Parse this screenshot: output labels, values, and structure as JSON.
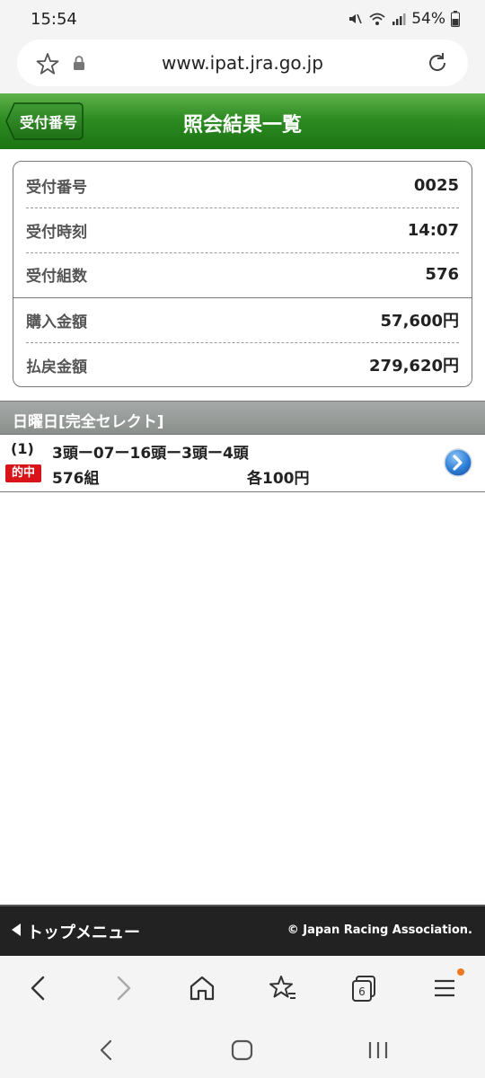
{
  "status_bar": {
    "time": "15:54",
    "battery": "54%",
    "icons": [
      "mute-icon",
      "wifi-icon",
      "signal-icon",
      "battery-icon"
    ]
  },
  "browser": {
    "url": "www.ipat.jra.go.jp",
    "tab_count": "6"
  },
  "header": {
    "back_label": "受付番号",
    "title": "照会結果一覧",
    "color": "#2e8c23"
  },
  "summary": {
    "rows": [
      {
        "label": "受付番号",
        "value": "0025"
      },
      {
        "label": "受付時刻",
        "value": "14:07"
      },
      {
        "label": "受付組数",
        "value": "576"
      },
      {
        "label": "購入金額",
        "value": "57,600円"
      },
      {
        "label": "払戻金額",
        "value": "279,620円"
      }
    ]
  },
  "section": {
    "title": "日曜日[完全セレクト]"
  },
  "bet": {
    "index": "(1)",
    "description": "3頭ー07ー16頭ー3頭ー4頭",
    "hit_label": "的中",
    "count": "576組",
    "amount": "各100円"
  },
  "footer": {
    "menu_label": "トップメニュー",
    "copyright": "© Japan Racing Association."
  }
}
